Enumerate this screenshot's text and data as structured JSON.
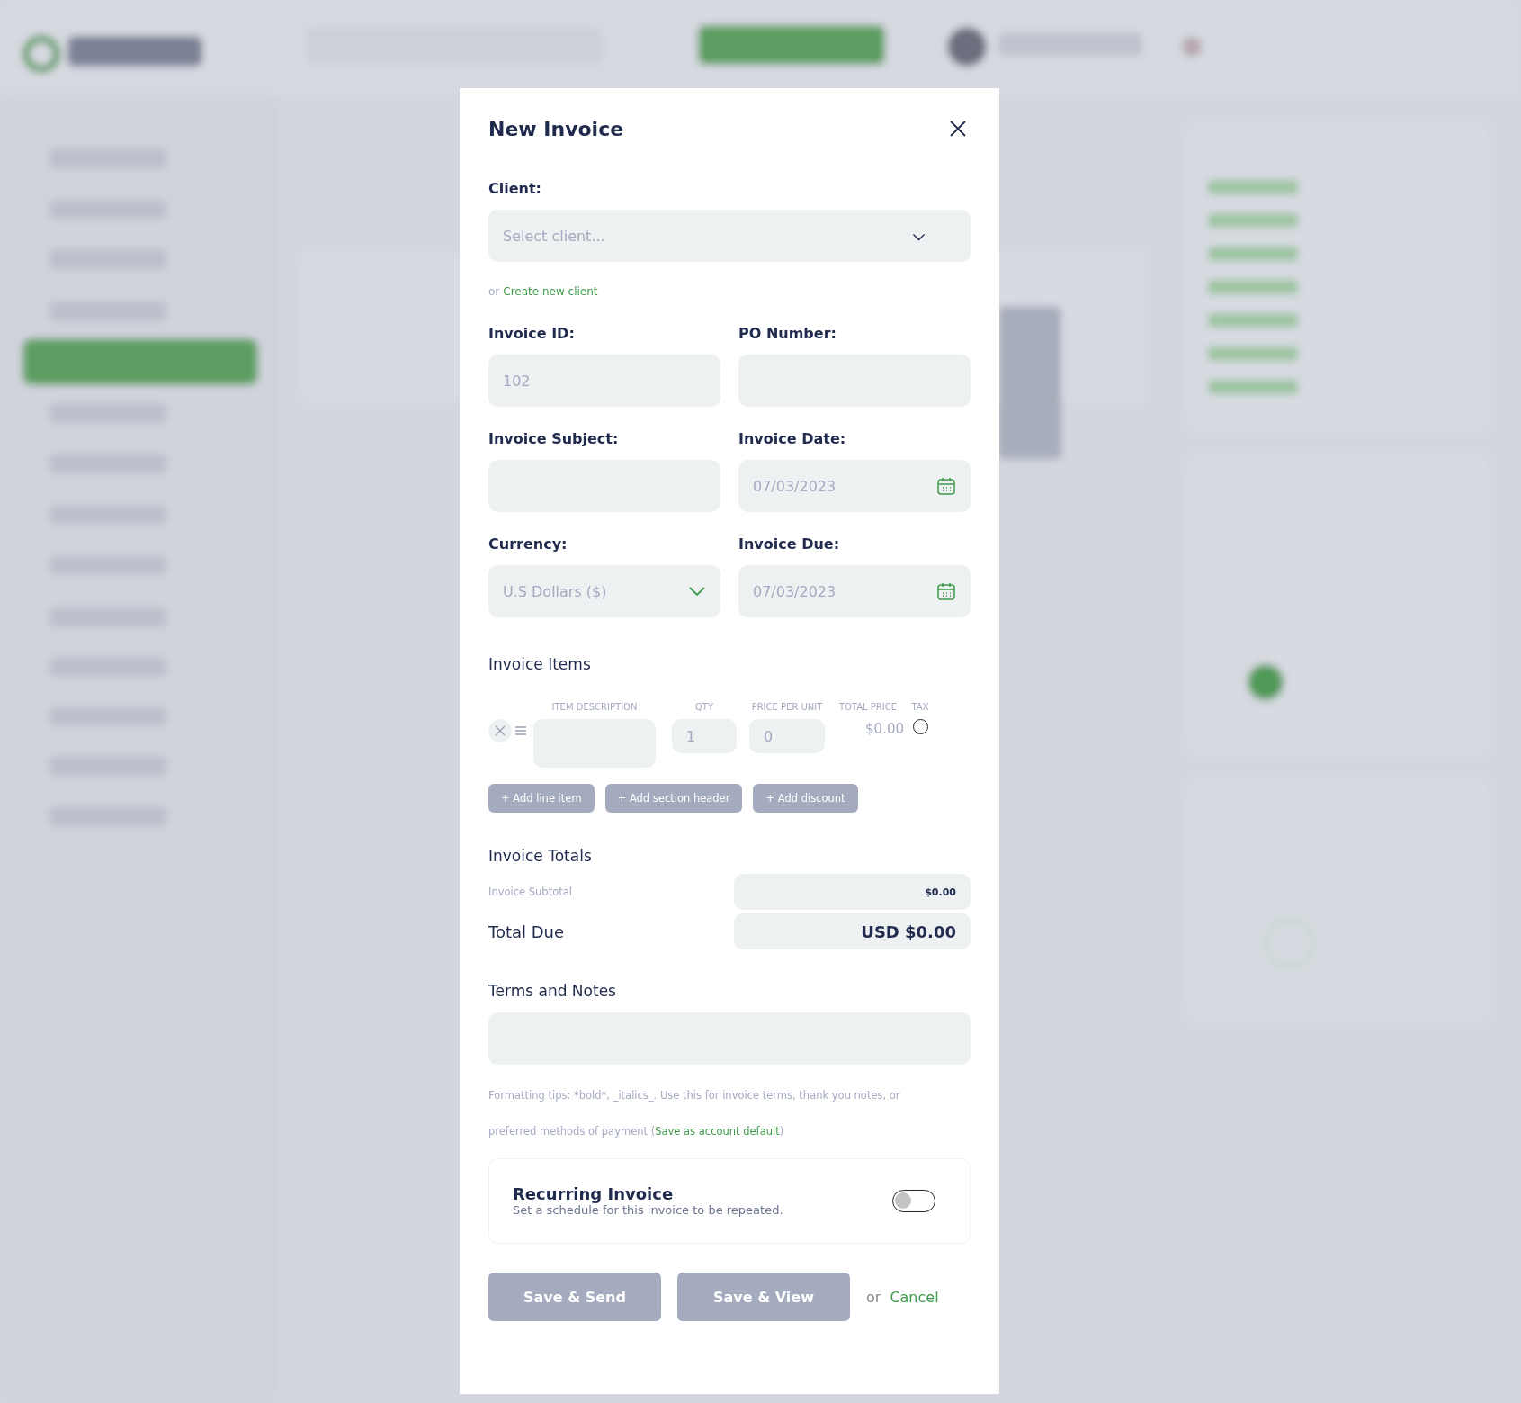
{
  "dialog": {
    "title": "New Invoice",
    "client": {
      "label": "Client:",
      "placeholder": "Select client...",
      "or": "or",
      "create_link": "Create new client"
    },
    "fields": [
      {
        "label": "Invoice ID:",
        "placeholder": "102",
        "kind": "text"
      },
      {
        "label": "PO Number:",
        "kind": "text"
      },
      {
        "label": "Invoice Subject:",
        "kind": "text"
      },
      {
        "label": "Invoice Date:",
        "placeholder": "07/03/2023",
        "kind": "date"
      },
      {
        "label": "Currency:",
        "value": "U.S Dollars ($)",
        "kind": "select"
      },
      {
        "label": "Invoice Due:",
        "placeholder": "07/03/2023",
        "kind": "date"
      }
    ],
    "items": {
      "title": "Invoice Items",
      "columns": [
        "ITEM DESCRIPTION",
        "QTY",
        "PRICE PER UNIT",
        "TOTAL PRICE",
        "TAX"
      ],
      "rows": [
        {
          "qty_placeholder": "1",
          "price_placeholder": "0",
          "total": "$0.00",
          "tax": false
        }
      ],
      "buttons": [
        "+ Add line item",
        "+ Add section header",
        "+ Add discount"
      ]
    },
    "totals": {
      "title": "Invoice Totals",
      "subtotal_label": "Invoice Subtotal",
      "subtotal": "$0.00",
      "due_label": "Total Due",
      "due": "USD $0.00"
    },
    "notes": {
      "title": "Terms and Notes",
      "tip": "Formatting tips: *bold*, _italics_. Use this for invoice terms, thank you notes, or preferred methods of payment (",
      "tip_link": "Save as account default",
      "tip_end": ")"
    },
    "recurring": {
      "title": "Recurring Invoice",
      "subtitle": "Set a schedule for this invoice to be repeated.",
      "on": false
    },
    "actions": {
      "buttons": [
        "Save & Send",
        "Save & View"
      ],
      "or": "or",
      "cancel": "Cancel"
    }
  }
}
